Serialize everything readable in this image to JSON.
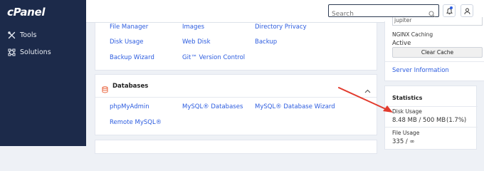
{
  "sidebar": {
    "logo": "cPanel",
    "items": [
      {
        "label": "Tools",
        "icon": "tools-icon"
      },
      {
        "label": "Solutions",
        "icon": "solutions-icon"
      }
    ]
  },
  "topbar": {
    "search_placeholder": "Search"
  },
  "files_section": {
    "links": [
      "File Manager",
      "Images",
      "Directory Privacy",
      "Disk Usage",
      "Web Disk",
      "Backup",
      "Backup Wizard",
      "Git™ Version Control"
    ]
  },
  "databases_section": {
    "title": "Databases",
    "links": [
      "phpMyAdmin",
      "MySQL® Databases",
      "MySQL® Database Wizard",
      "Remote MySQL®"
    ]
  },
  "right": {
    "top_cut_value": "jupiter",
    "nginx_label": "NGINX Caching",
    "nginx_value": "Active",
    "clear_cache_label": "Clear Cache",
    "server_info_link": "Server Information",
    "statistics_title": "Statistics",
    "disk_usage_label": "Disk Usage",
    "disk_usage_value": "8.48 MB / 500 MB",
    "disk_usage_percent": "(1.7%)",
    "file_usage_label": "File Usage",
    "file_usage_value": "335 / ∞"
  },
  "colors": {
    "sidebar_bg": "#1c2a4a",
    "link": "#2c5cdf",
    "db_icon": "#e8613a",
    "arrow": "#e23b2e"
  }
}
